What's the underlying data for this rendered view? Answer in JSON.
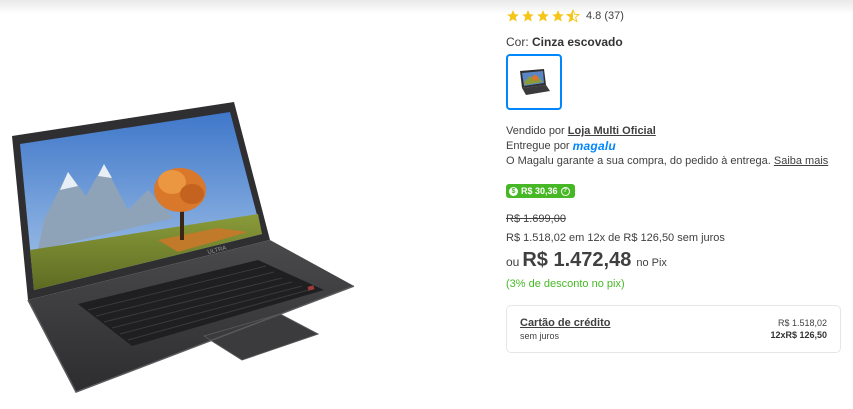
{
  "product": {
    "rating": {
      "stars": 4.5,
      "value": "4.8",
      "count": "(37)"
    },
    "color": {
      "label": "Cor:",
      "value": "Cinza escovado"
    },
    "seller": {
      "sold_by_label": "Vendido por",
      "sold_by_name": "Loja Multi Oficial",
      "delivered_by_label": "Entregue por",
      "delivered_by_logo": "magalu",
      "guarantee_text": "O Magalu garante a sua compra, do pedido à entrega.",
      "learn_more": "Saiba mais"
    },
    "cashback": {
      "text": "R$ 30,36",
      "coin_icon": "$",
      "info_icon": "?"
    },
    "prices": {
      "old": "R$ 1.699,00",
      "installments": "R$ 1.518,02 em 12x de R$ 126,50 sem juros",
      "pix_prefix": "ou",
      "pix_price": "R$ 1.472,48",
      "pix_suffix": "no Pix",
      "pix_discount": "(3% de desconto no pix)"
    },
    "payment_option": {
      "title": "Cartão de crédito",
      "subtitle": "sem juros",
      "total": "R$ 1.518,02",
      "installments": "12xR$ 126,50"
    },
    "laptop_logo": "ULTRA"
  },
  "colors": {
    "accent_blue": "#0086ff",
    "green": "#47b825",
    "star": "#f5c518",
    "text": "#404040"
  }
}
